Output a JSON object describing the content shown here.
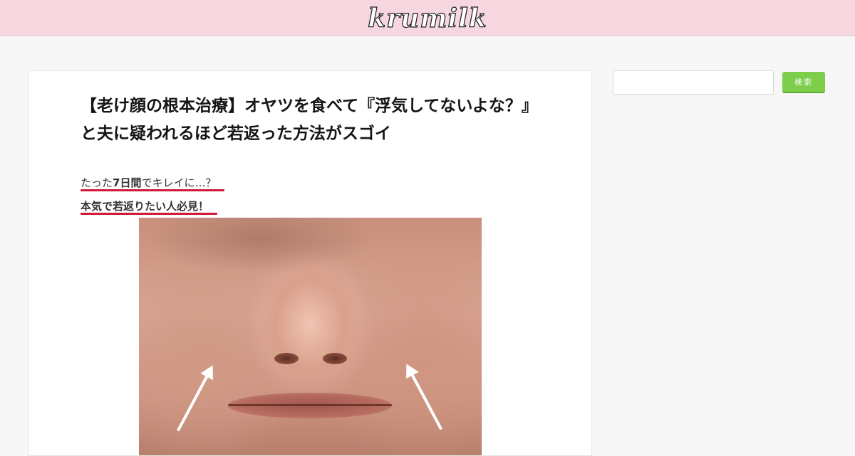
{
  "header": {
    "logo_text": "krumilk"
  },
  "article": {
    "title": "【老け顔の根本治療】オヤツを食べて『浮気してないよな？』と夫に疑われるほど若返った方法がスゴイ",
    "lead1_pre": "たった",
    "lead1_bold": "7日間",
    "lead1_post": "でキレイに…？",
    "lead2": "本気で若返りたい人必見！"
  },
  "sidebar": {
    "search_placeholder": "",
    "search_button_label": "検索"
  },
  "colors": {
    "header_bg": "#f6d7df",
    "accent_underline": "#d0183a",
    "search_button": "#7dce4b"
  }
}
